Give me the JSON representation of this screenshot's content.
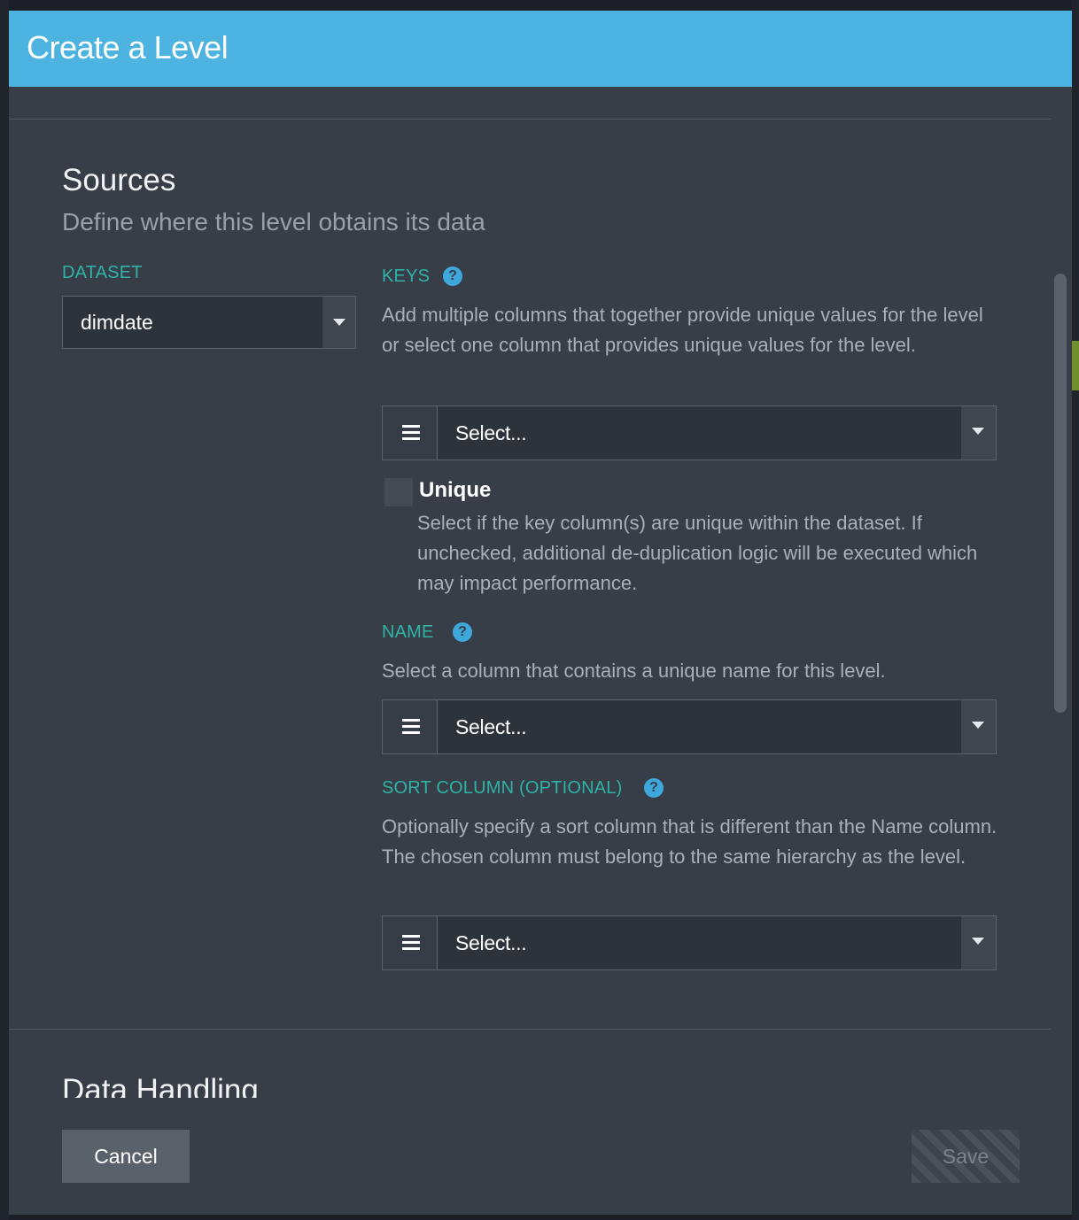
{
  "modal": {
    "title": "Create a Level"
  },
  "sources": {
    "title": "Sources",
    "subtitle": "Define where this level obtains its data",
    "dataset": {
      "label": "DATASET",
      "value": "dimdate"
    },
    "keys": {
      "label": "KEYS",
      "description": "Add multiple columns that together provide unique values for the level or select one column that provides unique values for the level.",
      "placeholder": "Select..."
    },
    "unique": {
      "label": "Unique",
      "checked": false,
      "description": "Select if the key column(s) are unique within the dataset. If unchecked, additional de-duplication logic will be executed which may impact performance."
    },
    "name": {
      "label": "NAME",
      "description": "Select a column that contains a unique name for this level.",
      "placeholder": "Select..."
    },
    "sort_column": {
      "label": "SORT COLUMN (OPTIONAL)",
      "description": "Optionally specify a sort column that is different than the Name column. The chosen column must belong to the same hierarchy as the level.",
      "placeholder": "Select..."
    }
  },
  "data_handling": {
    "title": "Data Handling"
  },
  "footer": {
    "cancel_label": "Cancel",
    "save_label": "Save"
  },
  "colors": {
    "header": "#4db3e0",
    "modal_bg": "#373e47",
    "label_teal": "#2fb3a5",
    "help_blue": "#3ea7dc"
  },
  "icons": {
    "help": "help-icon",
    "drag": "drag-handle-icon",
    "dropdown": "chevron-down-icon"
  }
}
